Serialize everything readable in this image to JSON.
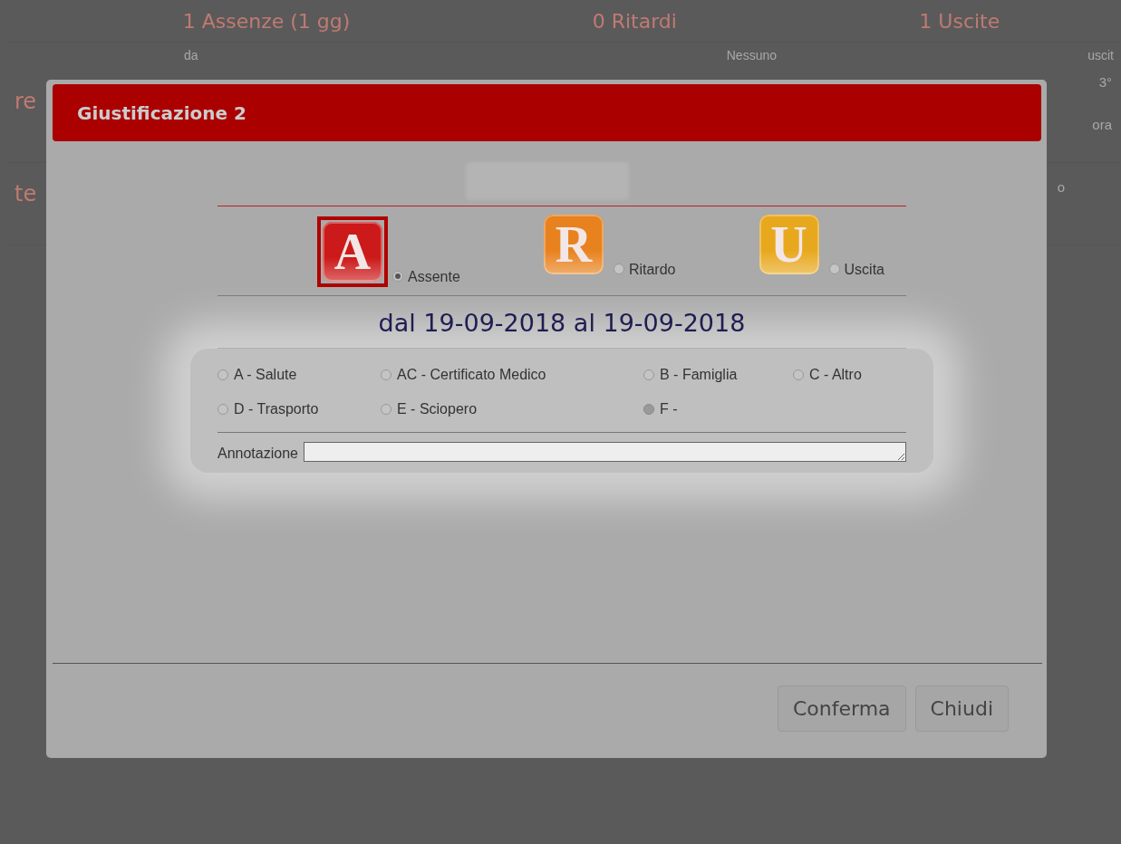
{
  "background": {
    "counts": [
      "1 Assenze (1 gg)",
      "0 Ritardi",
      "1 Uscite"
    ],
    "header_cells": [
      "da",
      "Nessuno",
      "uscit"
    ],
    "left_fragments": [
      "re",
      "te"
    ],
    "right_fragments": [
      "3°",
      "ora",
      "o"
    ]
  },
  "dialog": {
    "title": "Giustificazione 2",
    "types": [
      {
        "letter": "A",
        "label": "Assente",
        "selected": true,
        "color": "#cc1a1a"
      },
      {
        "letter": "R",
        "label": "Ritardo",
        "selected": false,
        "color": "#e8821e"
      },
      {
        "letter": "U",
        "label": "Uscita",
        "selected": false,
        "color": "#e8a81e"
      }
    ],
    "period": "dal 19-09-2018 al 19-09-2018",
    "reasons": [
      {
        "label": "A - Salute",
        "selected": false,
        "disabled": false
      },
      {
        "label": "AC - Certificato Medico",
        "selected": false,
        "disabled": false
      },
      {
        "label": "B - Famiglia",
        "selected": false,
        "disabled": false
      },
      {
        "label": "C - Altro",
        "selected": false,
        "disabled": false
      },
      {
        "label": "D - Trasporto",
        "selected": false,
        "disabled": false
      },
      {
        "label": "E - Sciopero",
        "selected": false,
        "disabled": false
      },
      {
        "label": "F -",
        "selected": false,
        "disabled": true
      }
    ],
    "note_label": "Annotazione",
    "buttons": [
      "Conferma",
      "Chiudi"
    ]
  }
}
